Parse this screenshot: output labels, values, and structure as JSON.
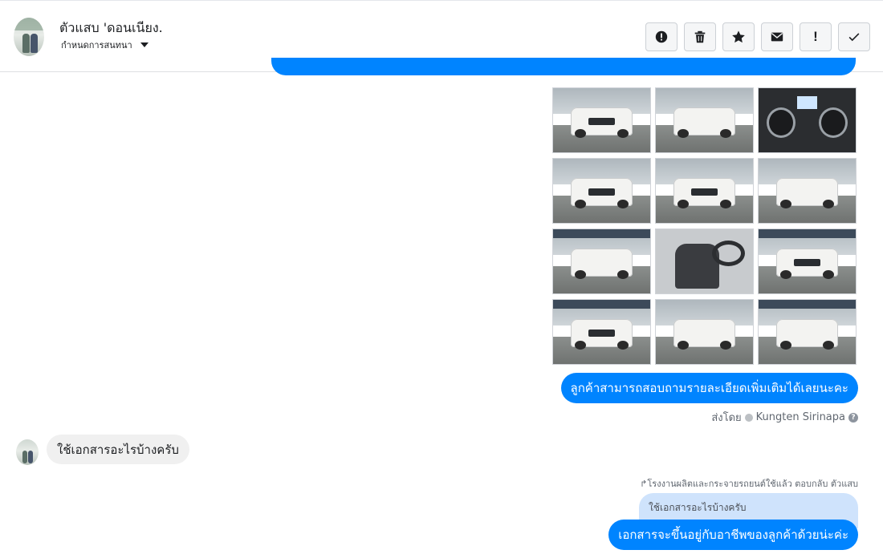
{
  "header": {
    "contact_name": "ตัวแสบ 'ดอนเนียง.",
    "conversation_settings": "กำหนดการสนทนา"
  },
  "toolbar": {
    "buttons": [
      {
        "name": "report-spam",
        "icon": "alert-circle-icon"
      },
      {
        "name": "delete",
        "icon": "trash-icon"
      },
      {
        "name": "star",
        "icon": "star-icon"
      },
      {
        "name": "mark-unread",
        "icon": "envelope-icon"
      },
      {
        "name": "follow-up",
        "icon": "exclamation-icon",
        "label": "!"
      },
      {
        "name": "mark-done",
        "icon": "check-icon"
      }
    ]
  },
  "conversation": {
    "photos": [
      {
        "kind": "truck-front"
      },
      {
        "kind": "truck-rear"
      },
      {
        "kind": "dashboard"
      },
      {
        "kind": "truck-front"
      },
      {
        "kind": "truck-front"
      },
      {
        "kind": "truck-rear"
      },
      {
        "kind": "truck-side"
      },
      {
        "kind": "seat"
      },
      {
        "kind": "truck-front"
      },
      {
        "kind": "truck-front"
      },
      {
        "kind": "truck-rear"
      },
      {
        "kind": "truck-side"
      }
    ],
    "outgoing_message_1": "ลูกค้าสามารถสอบถามรายละเอียดเพิ่มเติมได้เลยนะคะ",
    "sent_by_prefix": "ส่งโดย",
    "sent_by_name": "Kungten Sirinapa",
    "help_label": "?",
    "incoming_message": "ใช้เอกสารอะไรบ้างครับ",
    "reply_note": "โรงงานผลิตและกระจายรถยนต์ใช้แล้ว ตอบกลับ ตัวแสบ",
    "quoted_text": "ใช้เอกสารอะไรบ้างครับ",
    "outgoing_message_2": "เอกสารจะขึ้นอยู่กับอาชีพของลูกค้าด้วยน่ะค่ะ"
  },
  "colors": {
    "accent": "#0084ff",
    "incoming_bubble": "#f0f0f0",
    "quoted_bubble": "#cfe3fc"
  }
}
